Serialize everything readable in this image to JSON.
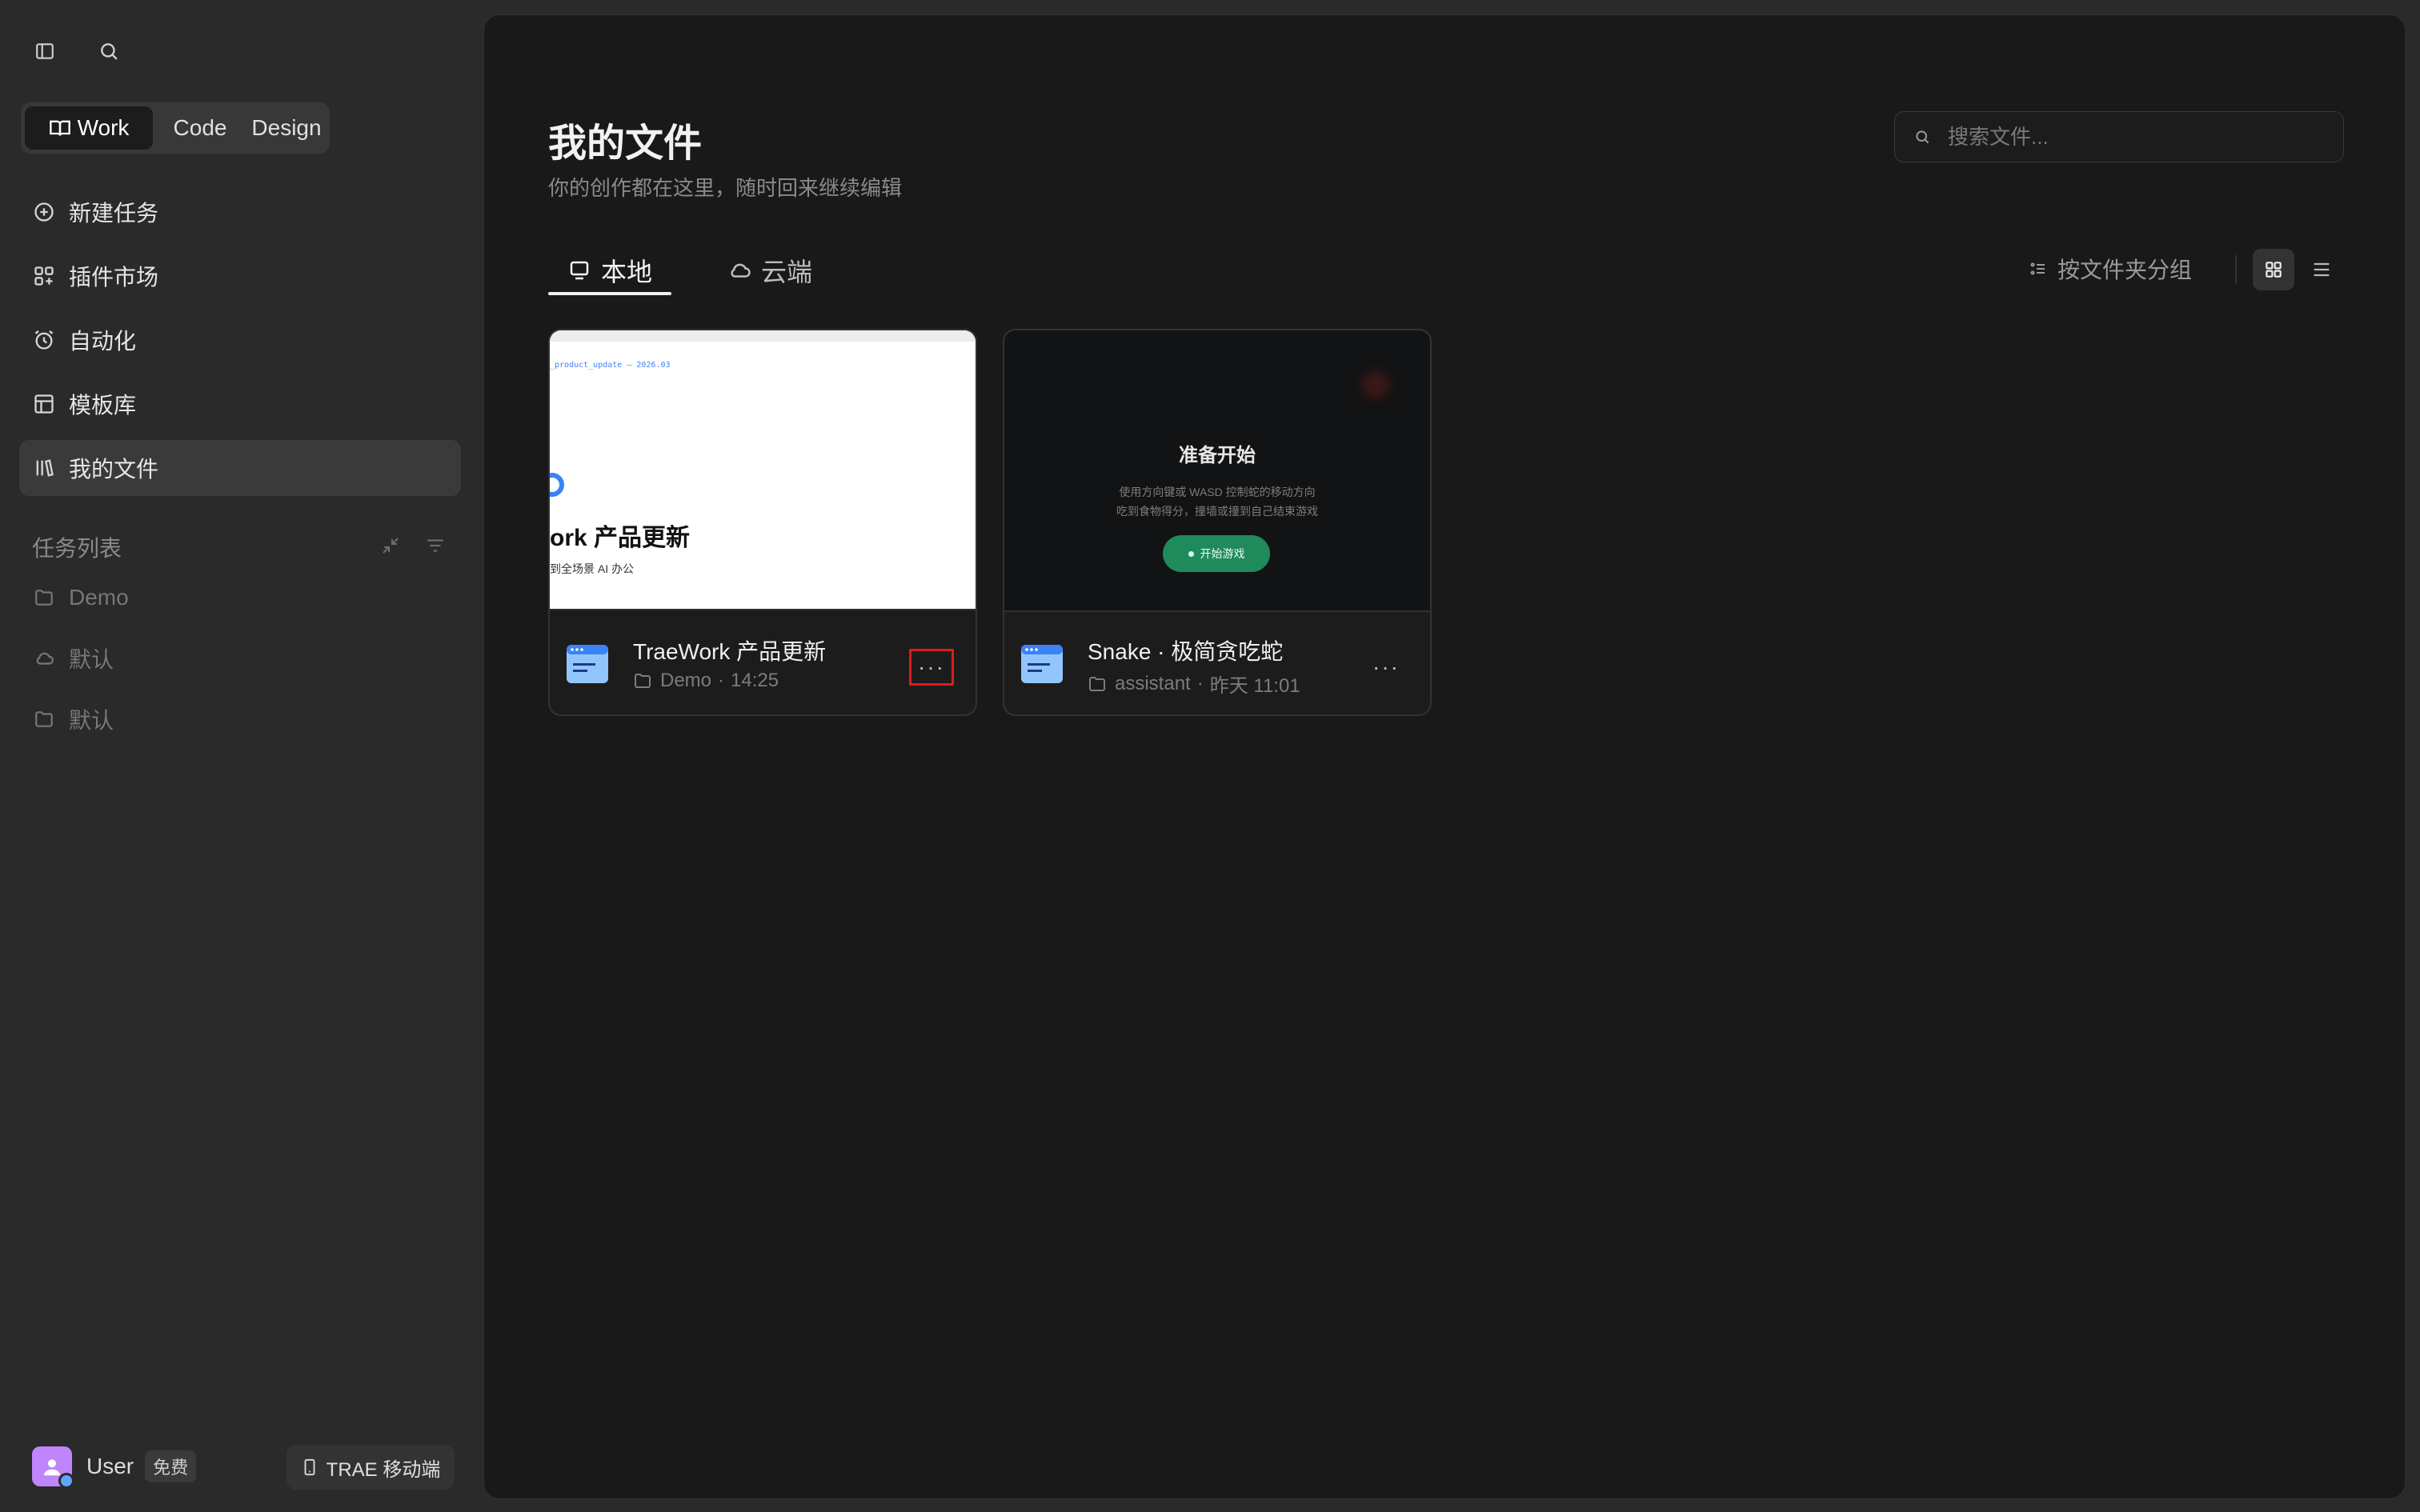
{
  "sidebar": {
    "modes": [
      {
        "label": "Work",
        "icon": "book-icon",
        "active": true
      },
      {
        "label": "Code",
        "active": false
      },
      {
        "label": "Design",
        "active": false
      }
    ],
    "nav": [
      {
        "label": "新建任务",
        "icon": "plus-circle-icon"
      },
      {
        "label": "插件市场",
        "icon": "grid-plus-icon"
      },
      {
        "label": "自动化",
        "icon": "alarm-clock-icon"
      },
      {
        "label": "模板库",
        "icon": "template-icon"
      },
      {
        "label": "我的文件",
        "icon": "library-icon",
        "active": true
      }
    ],
    "task_section_title": "任务列表",
    "tasks": [
      {
        "label": "Demo",
        "icon": "folder-icon"
      },
      {
        "label": "默认",
        "icon": "cloud-icon"
      },
      {
        "label": "默认",
        "icon": "folder-icon"
      }
    ],
    "user": {
      "name": "User",
      "plan": "免费"
    },
    "mobile_label": "TRAE 移动端"
  },
  "main": {
    "title": "我的文件",
    "subtitle": "你的创作都在这里，随时回来继续编辑",
    "search_placeholder": "搜索文件...",
    "tabs": [
      {
        "label": "本地",
        "icon": "monitor-icon",
        "active": true
      },
      {
        "label": "云端",
        "icon": "cloud-icon",
        "active": false
      }
    ],
    "group_by_label": "按文件夹分组",
    "view_mode": "grid",
    "files": [
      {
        "title": "TraeWork 产品更新",
        "folder": "Demo",
        "time": "14:25",
        "preview": {
          "code_line": "_product_update — 2026.03",
          "heading": "ork 产品更新",
          "sub": "到全场景 AI 办公"
        }
      },
      {
        "title": "Snake · 极简贪吃蛇",
        "folder": "assistant",
        "time": "昨天 11:01",
        "preview": {
          "heading": "准备开始",
          "line1": "使用方向键或 WASD 控制蛇的移动方向",
          "line2": "吃到食物得分，撞墙或撞到自己结束游戏",
          "button": "开始游戏"
        }
      }
    ],
    "meta_separator": "·",
    "more_label": "···"
  },
  "colors": {
    "accent_blue": "#3b82f6",
    "start_button_green": "#1f8a5b",
    "highlight_red": "#e01b1b",
    "avatar_purple": "#c084fc"
  }
}
